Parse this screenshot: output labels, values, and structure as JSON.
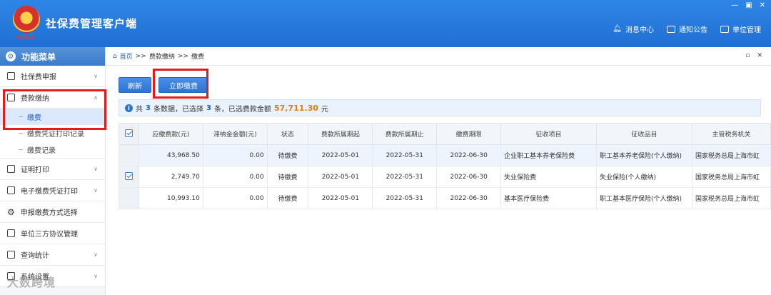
{
  "app": {
    "title": "社保费管理客户端",
    "logo_caption": "中国税务",
    "window_controls": [
      "—",
      "▣",
      "✕"
    ],
    "top_actions": [
      {
        "label": "消息中心",
        "icon": "bell-icon"
      },
      {
        "label": "通知公告",
        "icon": "mail-icon"
      },
      {
        "label": "单位管理",
        "icon": "building-icon"
      }
    ]
  },
  "sidebar": {
    "header": "功能菜单",
    "items": [
      {
        "label": "社保费申报",
        "icon": "form-icon",
        "expanded": false
      },
      {
        "label": "费款缴纳",
        "icon": "card-icon",
        "expanded": true,
        "children": [
          {
            "label": "缴费",
            "active": true
          },
          {
            "label": "缴费凭证打印记录",
            "active": false
          },
          {
            "label": "缴费记录",
            "active": false
          }
        ]
      },
      {
        "label": "证明打印",
        "icon": "print-icon",
        "expanded": false
      },
      {
        "label": "电子缴费凭证打印",
        "icon": "printer-icon",
        "expanded": false
      },
      {
        "label": "申报缴费方式选择",
        "icon": "gear-icon",
        "expanded": null
      },
      {
        "label": "单位三方协议管理",
        "icon": "agreement-icon",
        "expanded": null
      },
      {
        "label": "查询统计",
        "icon": "chart-icon",
        "expanded": false
      },
      {
        "label": "系统设置",
        "icon": "settings-icon",
        "expanded": false
      }
    ]
  },
  "main": {
    "breadcrumb": [
      "首页",
      ">>",
      "费款缴纳",
      ">>",
      "缴费"
    ],
    "buttons": {
      "refresh": "刷新",
      "pay_now": "立即缴费"
    },
    "info": {
      "prefix": "共",
      "total": "3",
      "mid1": "条数据，已选择",
      "selected": "3",
      "mid2": "条，已选费款金额",
      "amount": "57,711.30",
      "unit": "元"
    },
    "table": {
      "headers": [
        "应缴费款(元)",
        "滞纳金金额(元)",
        "状态",
        "费款所属期起",
        "费款所属期止",
        "缴费期限",
        "征收项目",
        "征收品目",
        "主管税务机关"
      ],
      "rows": [
        {
          "checked": false,
          "cells": [
            "43,968.50",
            "0.00",
            "待缴费",
            "2022-05-01",
            "2022-05-31",
            "2022-06-30",
            "企业职工基本养老保险费",
            "职工基本养老保险(个人缴纳)",
            "国家税务总局上海市虹"
          ]
        },
        {
          "checked": true,
          "cells": [
            "2,749.70",
            "0.00",
            "待缴费",
            "2022-05-01",
            "2022-05-31",
            "2022-06-30",
            "失业保险费",
            "失业保险(个人缴纳)",
            "国家税务总局上海市虹"
          ]
        },
        {
          "checked": false,
          "cells": [
            "10,993.10",
            "0.00",
            "待缴费",
            "2022-05-01",
            "2022-05-31",
            "2022-06-30",
            "基本医疗保险费",
            "职工基本医疗保险(个人缴纳)",
            "国家税务总局上海市虹"
          ]
        }
      ]
    }
  },
  "watermark": "大数跨境",
  "colors": {
    "title_bar": "#1f6fd4",
    "accent": "#2d73d3",
    "highlight_box": "#e31b1b",
    "amount": "#e37b10"
  }
}
